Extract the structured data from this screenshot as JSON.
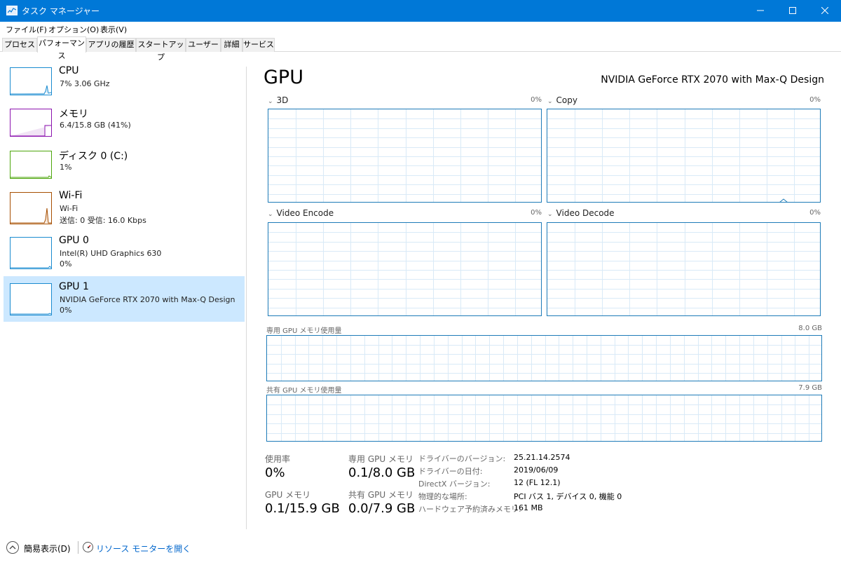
{
  "window": {
    "title": "タスク マネージャー"
  },
  "menu": [
    "ファイル(F)",
    "オプション(O)",
    "表示(V)"
  ],
  "tabs": [
    "プロセス",
    "パフォーマンス",
    "アプリの履歴",
    "スタートアップ",
    "ユーザー",
    "詳細",
    "サービス"
  ],
  "active_tab": "パフォーマンス",
  "sidebar": {
    "items": [
      {
        "name": "CPU",
        "lines": [
          "7%  3.06 GHz"
        ],
        "color": "#1a8bd0"
      },
      {
        "name": "メモリ",
        "lines": [
          "6.4/15.8 GB (41%)"
        ],
        "color": "#8b12ae"
      },
      {
        "name": "ディスク 0 (C:)",
        "lines": [
          "1%"
        ],
        "color": "#4da60c"
      },
      {
        "name": "Wi-Fi",
        "lines": [
          "Wi-Fi",
          "送信: 0 受信: 16.0 Kbps"
        ],
        "color": "#a74f01"
      },
      {
        "name": "GPU 0",
        "lines": [
          "Intel(R) UHD Graphics 630",
          "0%"
        ],
        "color": "#1a8bd0"
      },
      {
        "name": "GPU 1",
        "lines": [
          "NVIDIA GeForce RTX 2070 with Max-Q Design",
          "0%"
        ],
        "color": "#1a8bd0",
        "selected": true
      }
    ]
  },
  "main": {
    "title": "GPU",
    "device": "NVIDIA GeForce RTX 2070 with Max-Q Design",
    "engines": [
      {
        "name": "3D",
        "percent": "0%"
      },
      {
        "name": "Copy",
        "percent": "0%"
      },
      {
        "name": "Video Encode",
        "percent": "0%"
      },
      {
        "name": "Video Decode",
        "percent": "0%"
      }
    ],
    "dedicated_mem": {
      "label": "専用 GPU メモリ使用量",
      "capacity": "8.0 GB"
    },
    "shared_mem": {
      "label": "共有 GPU メモリ使用量",
      "capacity": "7.9 GB"
    },
    "stats": {
      "usage_label": "使用率",
      "usage_value": "0%",
      "ded_label": "専用 GPU メモリ",
      "ded_value": "0.1/8.0 GB",
      "gpumem_label": "GPU メモリ",
      "gpumem_value": "0.1/15.9 GB",
      "shared_label": "共有 GPU メモリ",
      "shared_value": "0.0/7.9 GB"
    },
    "info": [
      {
        "key": "ドライバーのバージョン:",
        "value": "25.21.14.2574"
      },
      {
        "key": "ドライバーの日付:",
        "value": "2019/06/09"
      },
      {
        "key": "DirectX バージョン:",
        "value": "12 (FL 12.1)"
      },
      {
        "key": "物理的な場所:",
        "value": "PCI バス 1, デバイス 0, 機能 0"
      },
      {
        "key": "ハードウェア予約済みメモリ:",
        "value": "161 MB"
      }
    ]
  },
  "footer": {
    "fewer_details": "簡易表示(D)",
    "resource_monitor": "リソース モニターを開く"
  },
  "colors": {
    "accent": "#0078d7",
    "graph_border": "#1e7bb8",
    "grid": "#d9eaf7",
    "selected": "#cce8ff"
  }
}
